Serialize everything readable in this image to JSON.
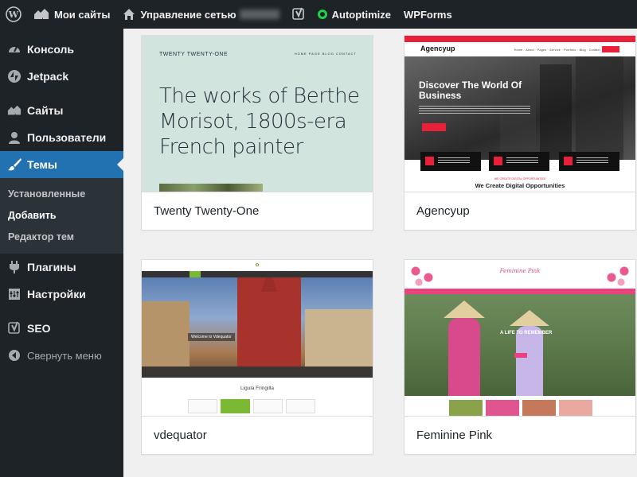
{
  "adminbar": {
    "my_sites": "Мои сайты",
    "network_admin": "Управление сетью",
    "autoptimize": "Autoptimize",
    "wpforms": "WPForms"
  },
  "sidebar": {
    "items": [
      {
        "label": "Консоль",
        "icon": "dashboard-icon"
      },
      {
        "label": "Jetpack",
        "icon": "jetpack-icon"
      },
      {
        "label": "Сайты",
        "icon": "sites-icon"
      },
      {
        "label": "Пользователи",
        "icon": "users-icon"
      },
      {
        "label": "Темы",
        "icon": "appearance-icon"
      }
    ],
    "submenu": [
      "Установленные",
      "Добавить",
      "Редактор тем"
    ],
    "items_after": [
      {
        "label": "Плагины",
        "icon": "plugins-icon"
      },
      {
        "label": "Настройки",
        "icon": "settings-icon"
      },
      {
        "label": "SEO",
        "icon": "yoast-icon"
      }
    ],
    "collapse": "Свернуть меню"
  },
  "themes": [
    {
      "name": "Twenty Twenty-One"
    },
    {
      "name": "Agencyup"
    },
    {
      "name": "vdequator"
    },
    {
      "name": "Feminine Pink"
    }
  ],
  "previews": {
    "tt1": {
      "brand": "TWENTY TWENTY-ONE",
      "nav": "HOME   PAGE   BLOG   CONTACT",
      "headline": "The works of Berthe Morisot, 1800s-era French painter"
    },
    "agencyup": {
      "logo": "Agencyup",
      "headline": "Discover The World Of Business",
      "tagline": "WE CREATE DIGITAL OPPORTUNITIES",
      "subhead": "We Create Digital Opportunities"
    },
    "vdequator": {
      "caption": "Welcome to Vdequator",
      "title": "Ligula Fringilla"
    },
    "feminine": {
      "title": "Feminine Pink",
      "hero_text": "A LIFE TO REMEMBER"
    }
  },
  "colors": {
    "admin_dark": "#1d2327",
    "accent": "#2271b1",
    "autoptimize_green": "#1ed14b"
  }
}
